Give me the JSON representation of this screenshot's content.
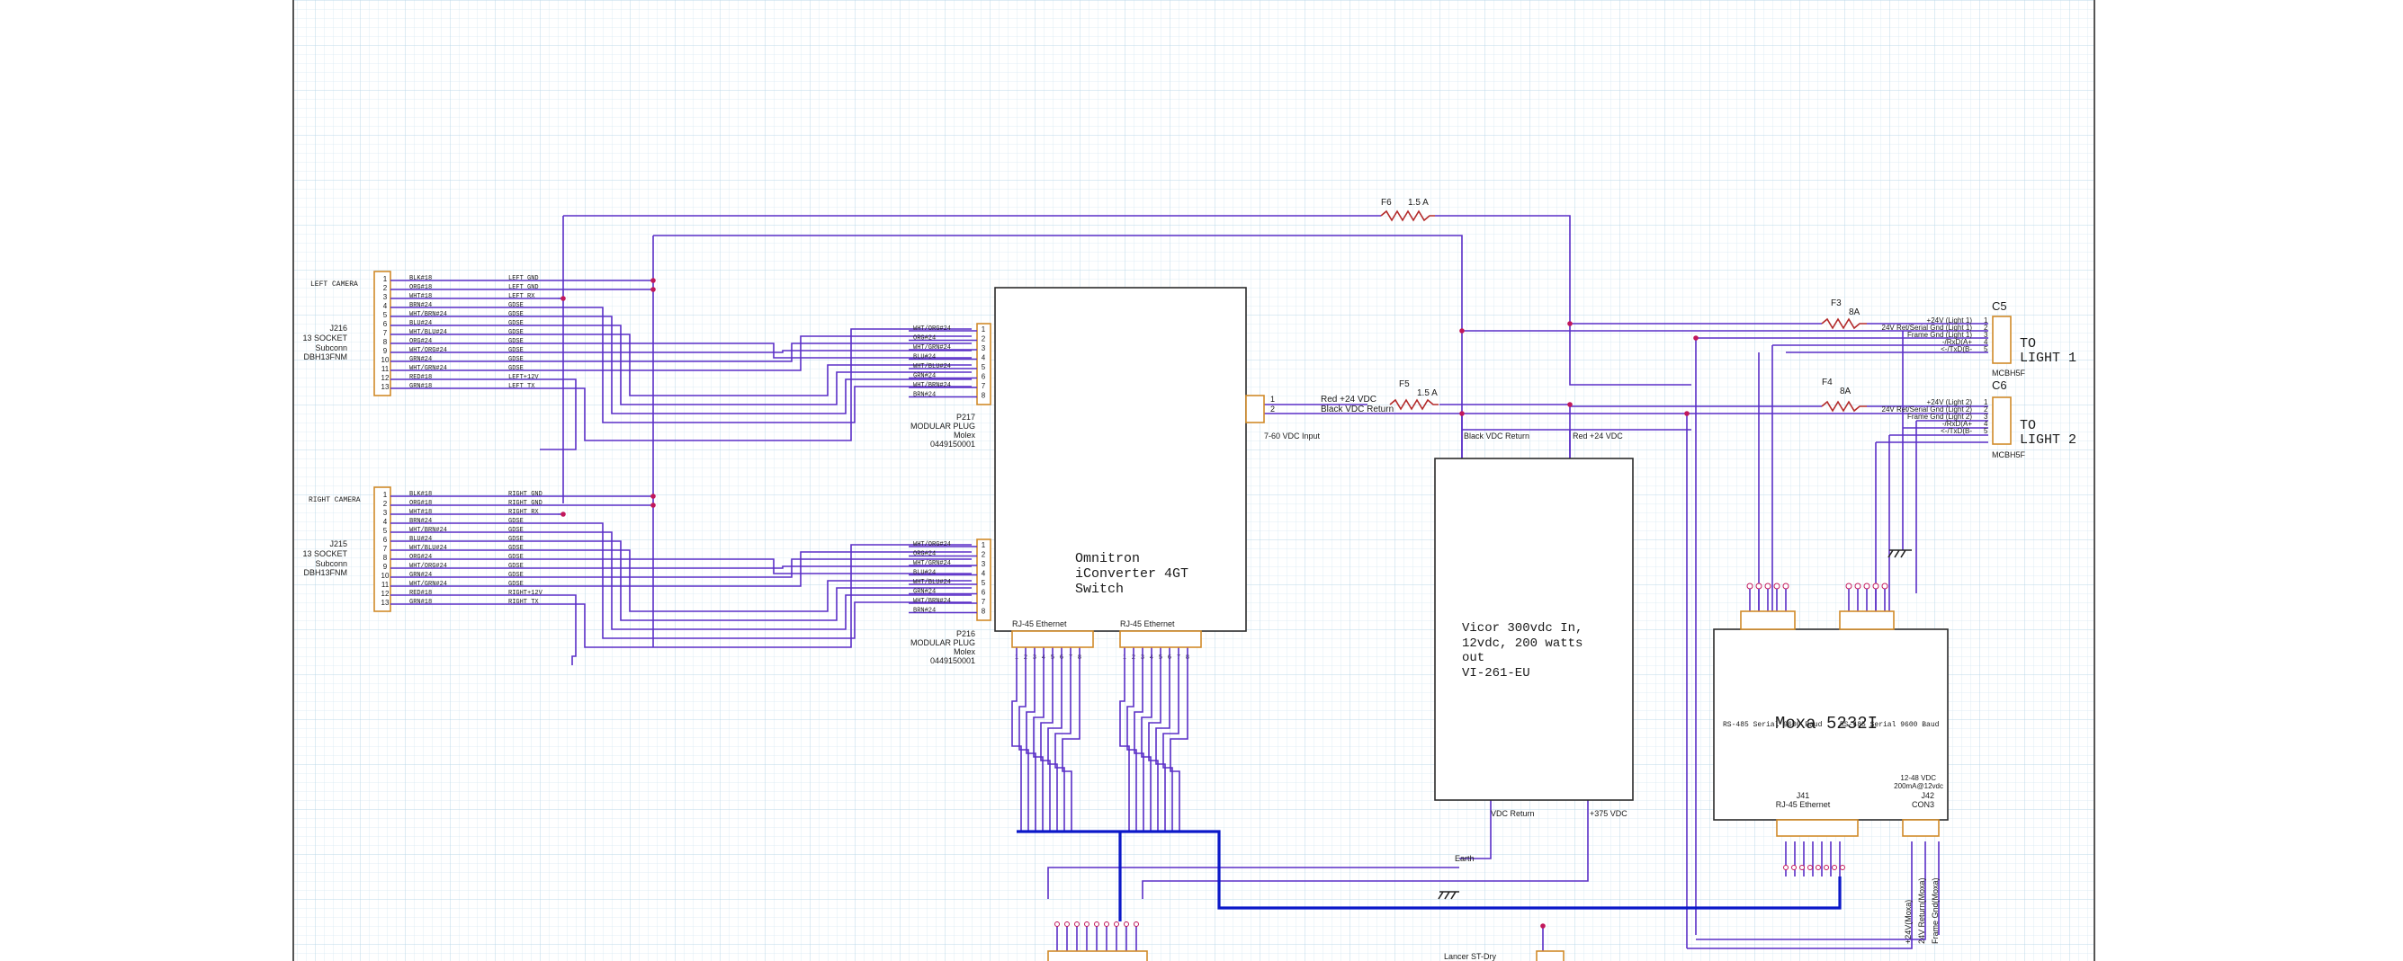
{
  "components": {
    "left_camera": {
      "label": "LEFT CAMERA",
      "ref": "J216",
      "desc": "13 SOCKET",
      "mfr": "Subconn",
      "part": "DBH13FNM"
    },
    "right_camera": {
      "label": "RIGHT CAMERA",
      "ref": "J215",
      "desc": "13 SOCKET",
      "mfr": "Subconn",
      "part": "DBH13FNM"
    },
    "p217": {
      "ref": "P217",
      "desc": "MODULAR PLUG",
      "mfr": "Molex",
      "part": "0449150001"
    },
    "p216": {
      "ref": "P216",
      "desc": "MODULAR PLUG",
      "mfr": "Molex",
      "part": "0449150001"
    },
    "switch": {
      "line1": "Omnitron",
      "line2": "iConverter 4GT",
      "line3": "Switch",
      "port1": "RJ-45 Ethernet",
      "port2": "RJ-45 Ethernet",
      "power_label": "7-60 VDC Input"
    },
    "vicor": {
      "line1": "Vicor 300vdc In,",
      "line2": "12vdc, 200 watts",
      "line3": "out",
      "line4": "VI-261-EU",
      "top_left": "Black  VDC Return",
      "top_right": "Red +24 VDC",
      "bottom_left": "VDC Return",
      "bottom_right": "+375 VDC"
    },
    "moxa": {
      "title": "Moxa 5232I",
      "serial1": "RS-485 Serial 9600 Baud",
      "serial2": "RS-485 Serial 9600 Baud",
      "j41": "J41",
      "j41_desc": "RJ-45 Ethernet",
      "j42": "J42",
      "j42_desc": "CON3",
      "power": "12-48 VDC",
      "power2": "200mA@12vdc"
    },
    "c5": {
      "ref": "C5",
      "to": "TO",
      "light": "LIGHT 1",
      "part": "MCBH5F"
    },
    "c6": {
      "ref": "C6",
      "to": "TO",
      "light": "LIGHT 2",
      "part": "MCBH5F"
    },
    "lancer": {
      "label": "Lancer ST-Dry"
    },
    "earth": {
      "label": "Earth"
    }
  },
  "fuses": {
    "f6": {
      "ref": "F6",
      "rating": "1.5 A"
    },
    "f5": {
      "ref": "F5",
      "rating": "1.5 A"
    },
    "f3": {
      "ref": "F3",
      "rating": "8A"
    },
    "f4": {
      "ref": "F4",
      "rating": "8A"
    }
  },
  "power_net": {
    "pin1": "1",
    "pin2": "2",
    "red": "Red +24 VDC",
    "black": "Black  VDC Return"
  },
  "light1_pins": {
    "labels": [
      "+24V (Light 1)",
      "24V Ret/Serial Gnd (Light 1)",
      "Frame Gnd (Light 1)",
      "-/RxD(A+",
      "<-/TxD(B-"
    ],
    "numbers": [
      "1",
      "2",
      "3",
      "4",
      "5"
    ]
  },
  "light2_pins": {
    "labels": [
      "+24V (Light 2)",
      "24V Ret/Serial Gnd (Light 2)",
      "Frame Gnd (Light 2)",
      "-/RxD(A+",
      "<-/TxD(B-"
    ],
    "numbers": [
      "1",
      "2",
      "3",
      "4",
      "5"
    ]
  },
  "moxa_power_labels": [
    "+24V(Moxa)",
    "24V Return(Moxa)",
    "Frame Gnd(Moxa)"
  ],
  "left_cam_wires": [
    {
      "pin": "1",
      "color": "BLK#18",
      "net": "LEFT GND"
    },
    {
      "pin": "2",
      "color": "ORG#18",
      "net": "LEFT GND"
    },
    {
      "pin": "3",
      "color": "WHT#18",
      "net": "LEFT RX"
    },
    {
      "pin": "4",
      "color": "BRN#24",
      "net": "GDSE"
    },
    {
      "pin": "5",
      "color": "WHT/BRN#24",
      "net": "GDSE"
    },
    {
      "pin": "6",
      "color": "BLU#24",
      "net": "GDSE"
    },
    {
      "pin": "7",
      "color": "WHT/BLU#24",
      "net": "GDSE"
    },
    {
      "pin": "8",
      "color": "ORG#24",
      "net": "GDSE"
    },
    {
      "pin": "9",
      "color": "WHT/ORG#24",
      "net": "GDSE"
    },
    {
      "pin": "10",
      "color": "GRN#24",
      "net": "GDSE"
    },
    {
      "pin": "11",
      "color": "WHT/GRN#24",
      "net": "GDSE"
    },
    {
      "pin": "12",
      "color": "RED#18",
      "net": "LEFT+12V"
    },
    {
      "pin": "13",
      "color": "GRN#18",
      "net": "LEFT TX"
    }
  ],
  "right_cam_wires": [
    {
      "pin": "1",
      "color": "BLK#18",
      "net": "RIGHT GND"
    },
    {
      "pin": "2",
      "color": "ORG#18",
      "net": "RIGHT GND"
    },
    {
      "pin": "3",
      "color": "WHT#18",
      "net": "RIGHT RX"
    },
    {
      "pin": "4",
      "color": "BRN#24",
      "net": "GDSE"
    },
    {
      "pin": "5",
      "color": "WHT/BRN#24",
      "net": "GDSE"
    },
    {
      "pin": "6",
      "color": "BLU#24",
      "net": "GDSE"
    },
    {
      "pin": "7",
      "color": "WHT/BLU#24",
      "net": "GDSE"
    },
    {
      "pin": "8",
      "color": "ORG#24",
      "net": "GDSE"
    },
    {
      "pin": "9",
      "color": "WHT/ORG#24",
      "net": "GDSE"
    },
    {
      "pin": "10",
      "color": "GRN#24",
      "net": "GDSE"
    },
    {
      "pin": "11",
      "color": "WHT/GRN#24",
      "net": "GDSE"
    },
    {
      "pin": "12",
      "color": "RED#18",
      "net": "RIGHT+12V"
    },
    {
      "pin": "13",
      "color": "GRN#18",
      "net": "RIGHT TX"
    }
  ],
  "p217_wires": [
    {
      "pin": "1",
      "color": "WHT/ORG#24"
    },
    {
      "pin": "2",
      "color": "ORG#24"
    },
    {
      "pin": "3",
      "color": "WHT/GRN#24"
    },
    {
      "pin": "4",
      "color": "BLU#24"
    },
    {
      "pin": "5",
      "color": "WHT/BLU#24"
    },
    {
      "pin": "6",
      "color": "GRN#24"
    },
    {
      "pin": "7",
      "color": "WHT/BRN#24"
    },
    {
      "pin": "8",
      "color": "BRN#24"
    }
  ],
  "p216_wires": [
    {
      "pin": "1",
      "color": "WHT/ORG#24"
    },
    {
      "pin": "2",
      "color": "ORG#24"
    },
    {
      "pin": "3",
      "color": "WHT/GRN#24"
    },
    {
      "pin": "4",
      "color": "BLU#24"
    },
    {
      "pin": "5",
      "color": "WHT/BLU#24"
    },
    {
      "pin": "6",
      "color": "GRN#24"
    },
    {
      "pin": "7",
      "color": "WHT/BRN#24"
    },
    {
      "pin": "8",
      "color": "BRN#24"
    }
  ],
  "colors": {
    "grid": "#d7e9f2",
    "grid_major": "#bcd9e8",
    "wire": "#5a2fc7",
    "bus": "#0b18c9",
    "connector": "#d08a2a",
    "fuse": "#b32a2a",
    "node": "#c2185b"
  }
}
